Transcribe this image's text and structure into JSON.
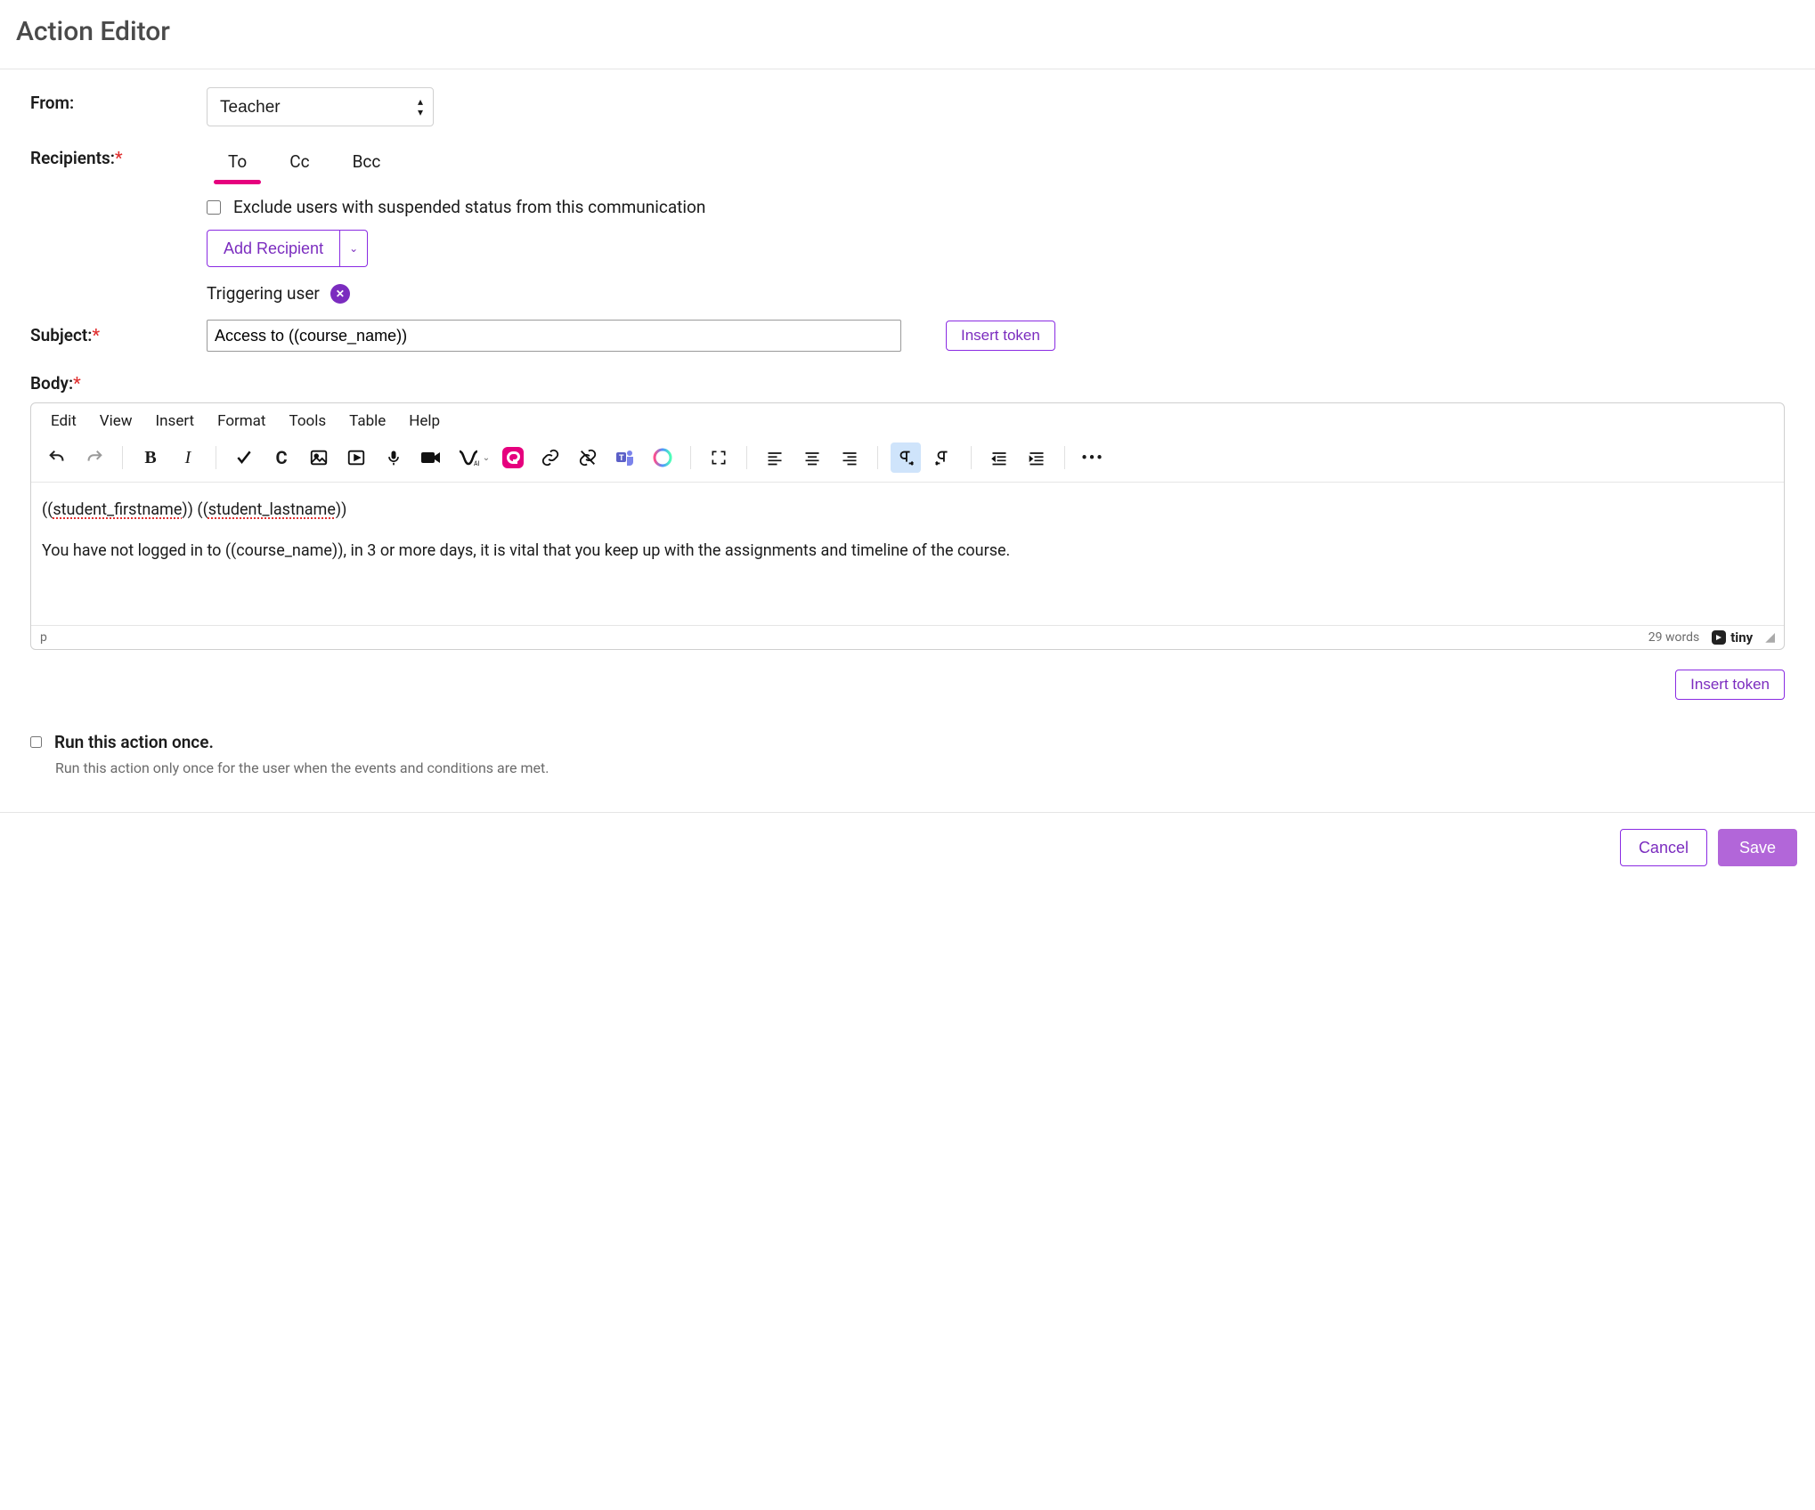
{
  "title": "Action Editor",
  "from": {
    "label": "From:",
    "value": "Teacher"
  },
  "recipients": {
    "label": "Recipients:",
    "tabs": [
      "To",
      "Cc",
      "Bcc"
    ],
    "activeTab": 0,
    "excludeLabel": "Exclude users with suspended status from this communication",
    "addRecipientLabel": "Add Recipient",
    "items": [
      {
        "name": "Triggering user"
      }
    ]
  },
  "subject": {
    "label": "Subject:",
    "value": "Access to ((course_name))",
    "insertTokenLabel": "Insert token"
  },
  "body": {
    "label": "Body:",
    "menubar": [
      "Edit",
      "View",
      "Insert",
      "Format",
      "Tools",
      "Table",
      "Help"
    ],
    "content_line1_prefix": "((",
    "content_line1_t1": "student_firstname",
    "content_line1_mid": ")) ((",
    "content_line1_t2": "student_lastname",
    "content_line1_suffix": "))",
    "content_line2": "You have not logged in to ((course_name)), in 3 or more days, it is vital that you keep up with the assignments and timeline of the course.",
    "statusPath": "p",
    "wordCount": "29 words",
    "tinyLabel": "tiny",
    "insertTokenLabel": "Insert token"
  },
  "runOnce": {
    "title": "Run this action once.",
    "description": "Run this action only once for the user when the events and conditions are met."
  },
  "footer": {
    "cancel": "Cancel",
    "save": "Save"
  }
}
